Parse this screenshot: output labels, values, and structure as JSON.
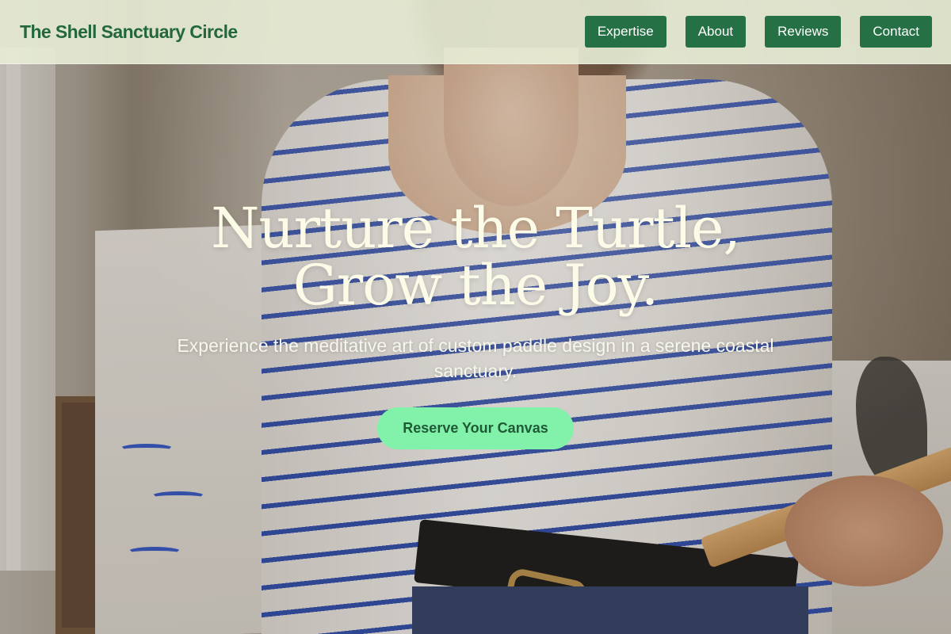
{
  "brand": {
    "name": "The Shell Sanctuary Circle"
  },
  "nav": {
    "items": [
      {
        "label": "Expertise"
      },
      {
        "label": "About"
      },
      {
        "label": "Reviews"
      },
      {
        "label": "Contact"
      }
    ]
  },
  "hero": {
    "title": "Nurture the Turtle, Grow the Joy.",
    "subtitle": "Experience the meditative art of custom paddle design in a serene coastal sanctuary.",
    "cta_label": "Reserve Your Canvas",
    "background_description": ""
  },
  "colors": {
    "nav_bg": "#e8edd6",
    "brand": "#23683d",
    "nav_button": "#267045",
    "nav_button_text": "#ffffff",
    "title": "#fbfbe8",
    "cta_bg": "#82f2aa",
    "cta_text": "#1f5a35"
  }
}
